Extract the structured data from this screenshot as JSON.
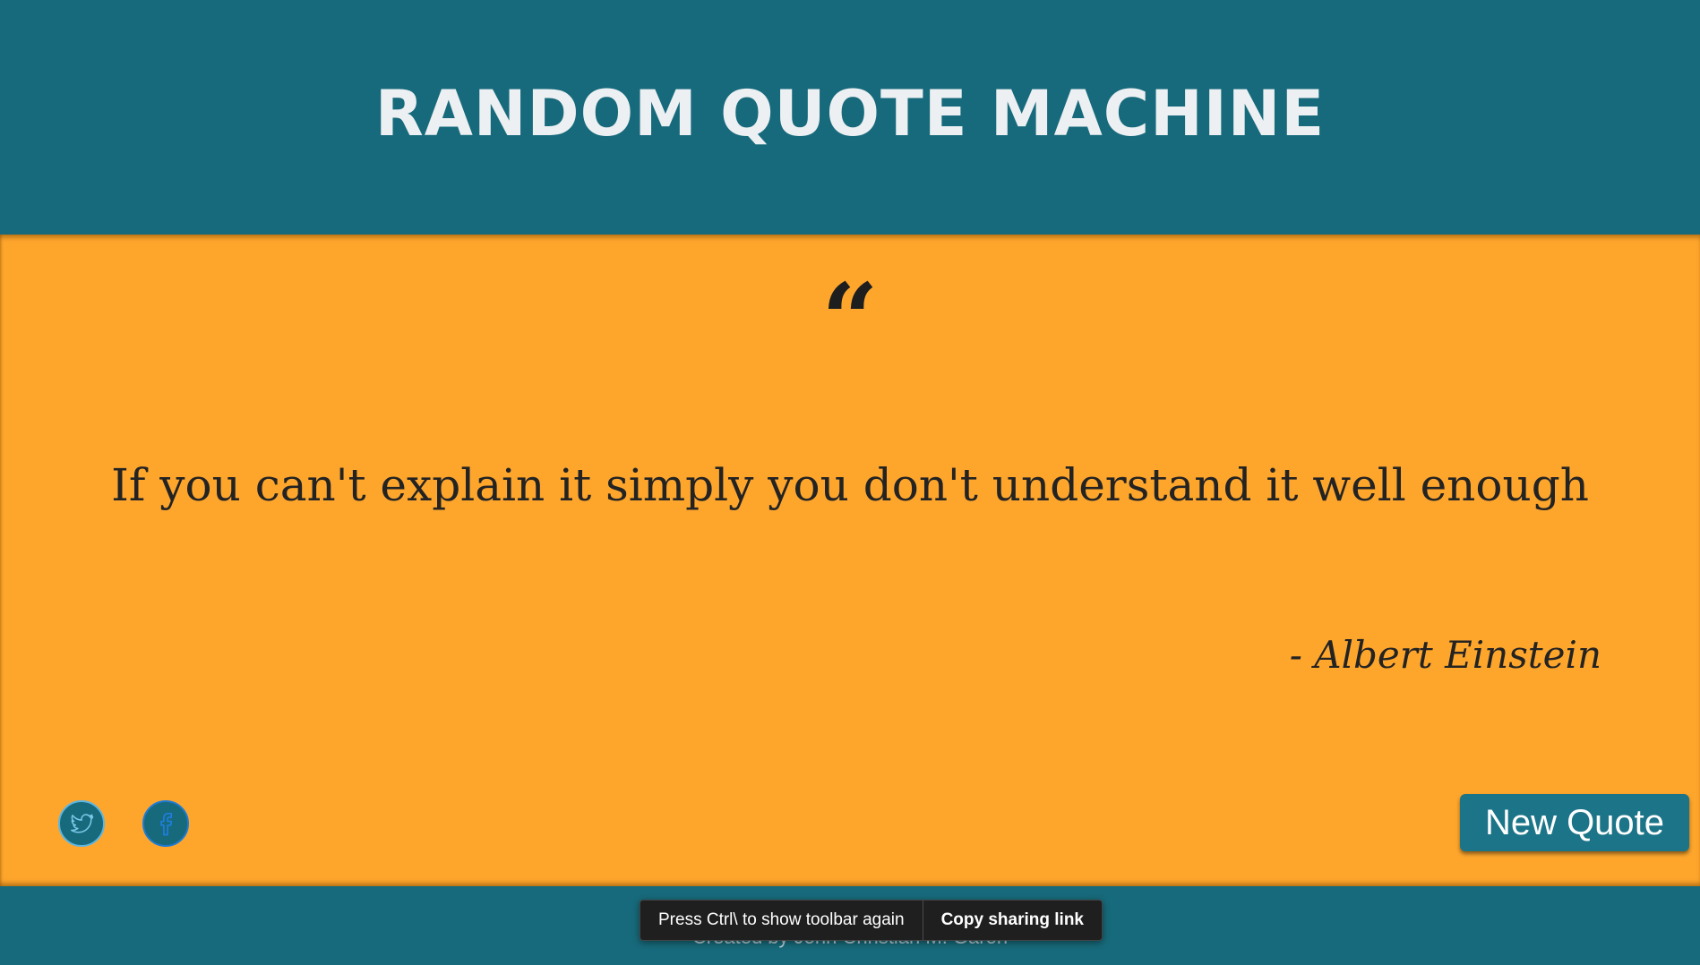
{
  "header": {
    "title": "RANDOM QUOTE MACHINE"
  },
  "quote": {
    "mark": "“",
    "text": "If you can't explain it simply you don't understand it well enough",
    "author": "- Albert Einstein"
  },
  "actions": {
    "twitter_icon": "twitter-icon",
    "facebook_icon": "facebook-icon",
    "new_quote_label": "New Quote"
  },
  "footer": {
    "credit": "Created by John Christian M. Garon"
  },
  "toolbar_toast": {
    "message": "Press Ctrl\\ to show toolbar again",
    "button_label": "Copy sharing link"
  },
  "colors": {
    "header_bg": "#176a7b",
    "quote_bg": "#fea62c",
    "button_bg": "#1c7488"
  }
}
